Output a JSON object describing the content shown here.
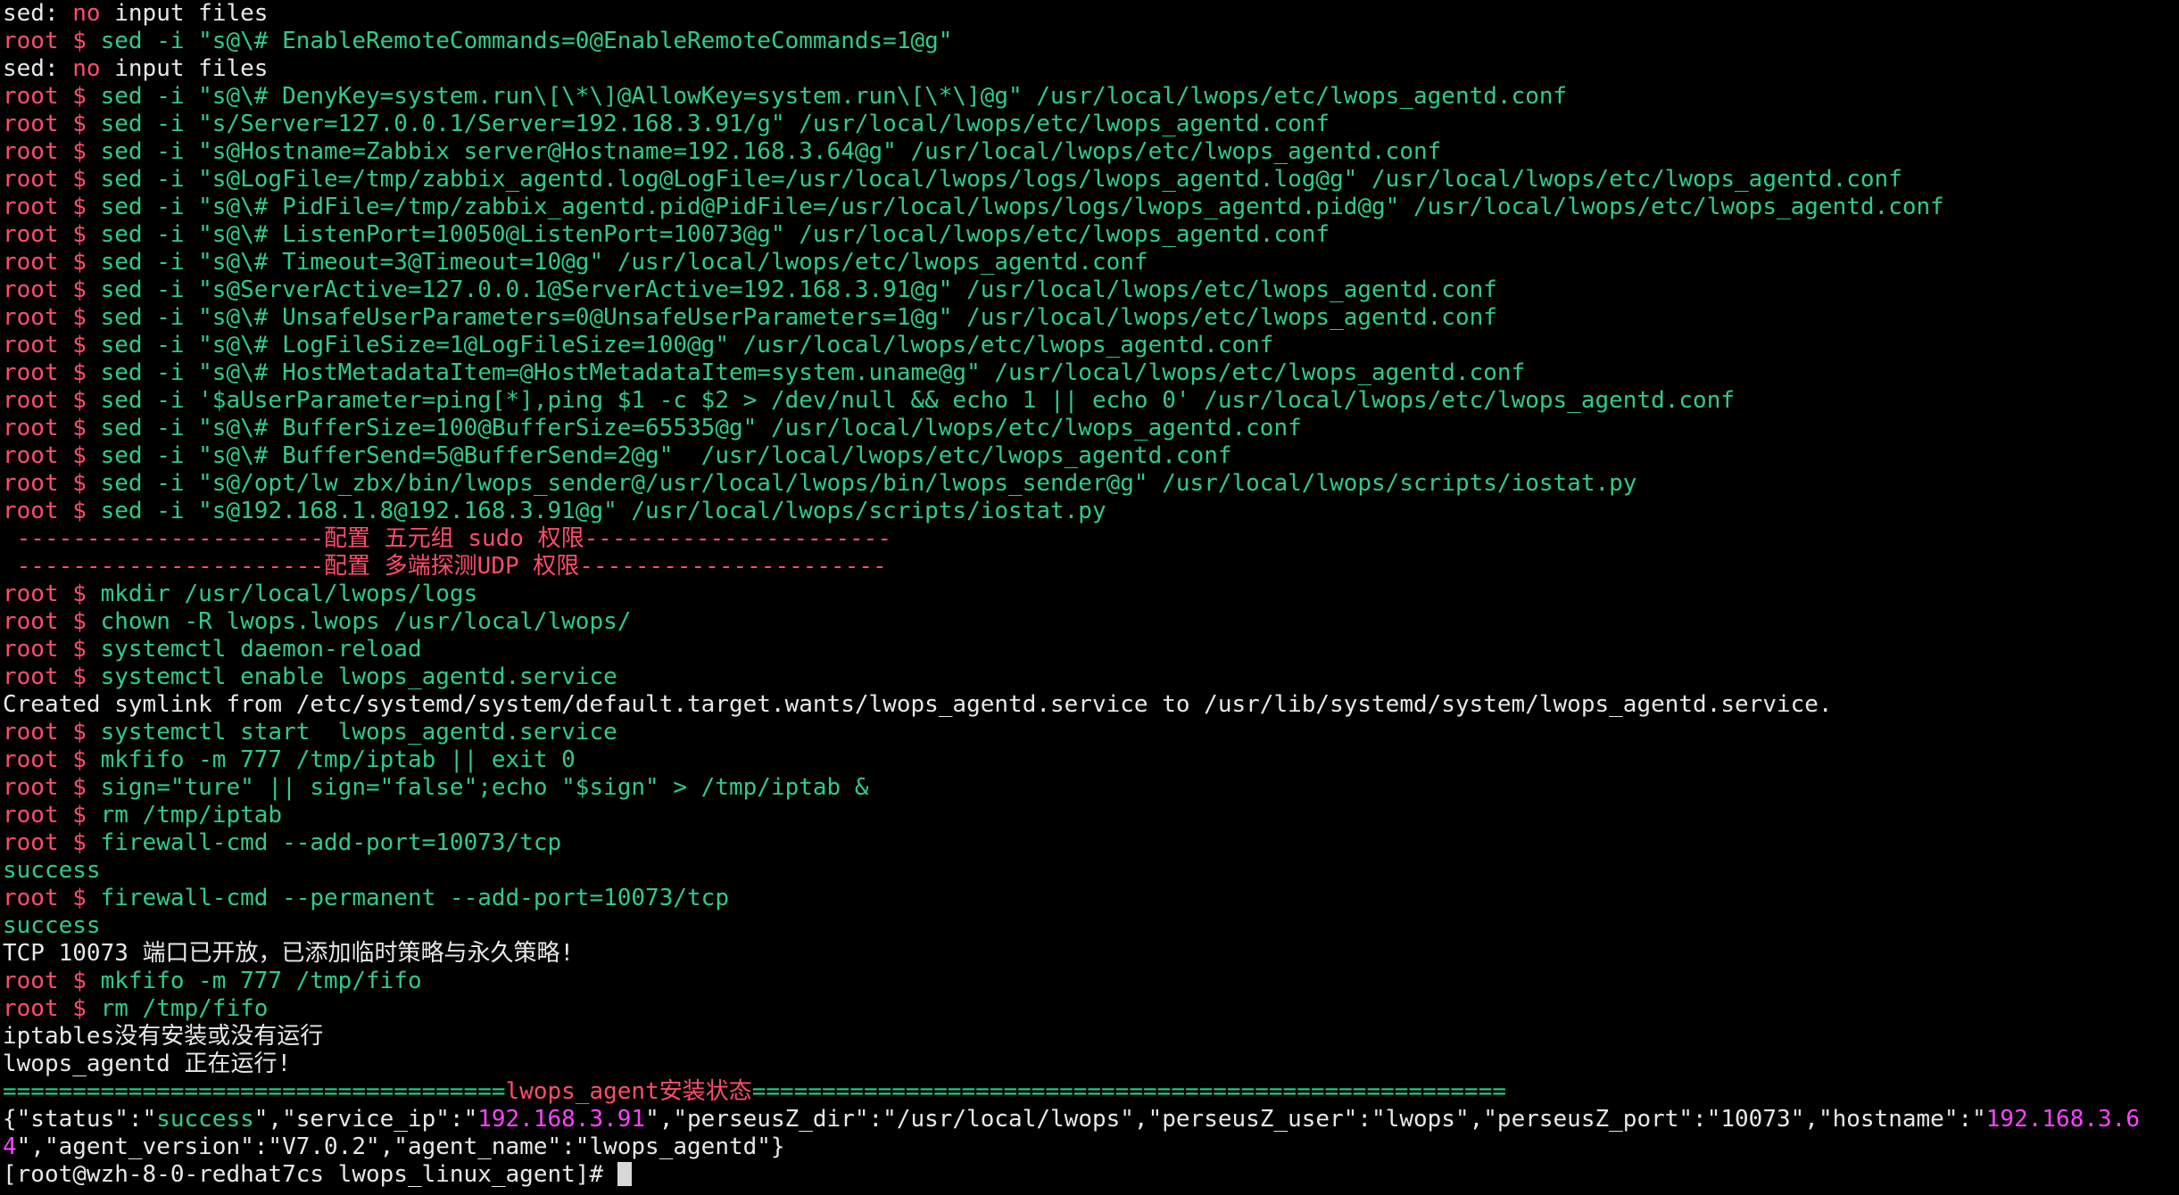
{
  "terminal": {
    "lines": [
      [
        [
          "w",
          "sed: "
        ],
        [
          "r",
          "no"
        ],
        [
          "w",
          " input files"
        ]
      ],
      [
        [
          "r",
          "root $ "
        ],
        [
          "g",
          "sed -i \"s@\\# EnableRemoteCommands=0@EnableRemoteCommands=1@g\""
        ]
      ],
      [
        [
          "w",
          "sed: "
        ],
        [
          "r",
          "no"
        ],
        [
          "w",
          " input files"
        ]
      ],
      [
        [
          "r",
          "root $ "
        ],
        [
          "g",
          "sed -i \"s@\\# DenyKey=system.run\\[\\*\\]@AllowKey=system.run\\[\\*\\]@g\" /usr/local/lwops/etc/lwops_agentd.conf"
        ]
      ],
      [
        [
          "r",
          "root $ "
        ],
        [
          "g",
          "sed -i \"s/Server=127.0.0.1/Server=192.168.3.91/g\" /usr/local/lwops/etc/lwops_agentd.conf"
        ]
      ],
      [
        [
          "r",
          "root $ "
        ],
        [
          "g",
          "sed -i \"s@Hostname=Zabbix server@Hostname=192.168.3.64@g\" /usr/local/lwops/etc/lwops_agentd.conf"
        ]
      ],
      [
        [
          "r",
          "root $ "
        ],
        [
          "g",
          "sed -i \"s@LogFile=/tmp/zabbix_agentd.log@LogFile=/usr/local/lwops/logs/lwops_agentd.log@g\" /usr/local/lwops/etc/lwops_agentd.conf"
        ]
      ],
      [
        [
          "r",
          "root $ "
        ],
        [
          "g",
          "sed -i \"s@\\# PidFile=/tmp/zabbix_agentd.pid@PidFile=/usr/local/lwops/logs/lwops_agentd.pid@g\" /usr/local/lwops/etc/lwops_agentd.conf"
        ]
      ],
      [
        [
          "r",
          "root $ "
        ],
        [
          "g",
          "sed -i \"s@\\# ListenPort=10050@ListenPort=10073@g\" /usr/local/lwops/etc/lwops_agentd.conf"
        ]
      ],
      [
        [
          "r",
          "root $ "
        ],
        [
          "g",
          "sed -i \"s@\\# Timeout=3@Timeout=10@g\" /usr/local/lwops/etc/lwops_agentd.conf"
        ]
      ],
      [
        [
          "r",
          "root $ "
        ],
        [
          "g",
          "sed -i \"s@ServerActive=127.0.0.1@ServerActive=192.168.3.91@g\" /usr/local/lwops/etc/lwops_agentd.conf"
        ]
      ],
      [
        [
          "r",
          "root $ "
        ],
        [
          "g",
          "sed -i \"s@\\# UnsafeUserParameters=0@UnsafeUserParameters=1@g\" /usr/local/lwops/etc/lwops_agentd.conf"
        ]
      ],
      [
        [
          "r",
          "root $ "
        ],
        [
          "g",
          "sed -i \"s@\\# LogFileSize=1@LogFileSize=100@g\" /usr/local/lwops/etc/lwops_agentd.conf"
        ]
      ],
      [
        [
          "r",
          "root $ "
        ],
        [
          "g",
          "sed -i \"s@\\# HostMetadataItem=@HostMetadataItem=system.uname@g\" /usr/local/lwops/etc/lwops_agentd.conf"
        ]
      ],
      [
        [
          "r",
          "root $ "
        ],
        [
          "g",
          "sed -i '$aUserParameter=ping[*],ping $1 -c $2 > /dev/null && echo 1 || echo 0' /usr/local/lwops/etc/lwops_agentd.conf"
        ]
      ],
      [
        [
          "r",
          "root $ "
        ],
        [
          "g",
          "sed -i \"s@\\# BufferSize=100@BufferSize=65535@g\" /usr/local/lwops/etc/lwops_agentd.conf"
        ]
      ],
      [
        [
          "r",
          "root $ "
        ],
        [
          "g",
          "sed -i \"s@\\# BufferSend=5@BufferSend=2@g\"  /usr/local/lwops/etc/lwops_agentd.conf"
        ]
      ],
      [
        [
          "r",
          "root $ "
        ],
        [
          "g",
          "sed -i \"s@/opt/lw_zbx/bin/lwops_sender@/usr/local/lwops/bin/lwops_sender@g\" /usr/local/lwops/scripts/iostat.py"
        ]
      ],
      [
        [
          "r",
          "root $ "
        ],
        [
          "g",
          "sed -i \"s@192.168.1.8@192.168.3.91@g\" /usr/local/lwops/scripts/iostat.py"
        ]
      ],
      [
        [
          "r",
          " ----------------------配置 五元组 sudo 权限----------------------"
        ]
      ],
      [
        [
          "r",
          " ----------------------配置 多端探测UDP 权限----------------------"
        ]
      ],
      [
        [
          "r",
          "root $ "
        ],
        [
          "g",
          "mkdir /usr/local/lwops/logs"
        ]
      ],
      [
        [
          "r",
          "root $ "
        ],
        [
          "g",
          "chown -R lwops.lwops /usr/local/lwops/"
        ]
      ],
      [
        [
          "r",
          "root $ "
        ],
        [
          "g",
          "systemctl daemon-reload"
        ]
      ],
      [
        [
          "r",
          "root $ "
        ],
        [
          "g",
          "systemctl enable lwops_agentd.service"
        ]
      ],
      [
        [
          "w",
          "Created symlink from /etc/systemd/system/default.target.wants/lwops_agentd.service to /usr/lib/systemd/system/lwops_agentd.service."
        ]
      ],
      [
        [
          "r",
          "root $ "
        ],
        [
          "g",
          "systemctl start  lwops_agentd.service"
        ]
      ],
      [
        [
          "r",
          "root $ "
        ],
        [
          "g",
          "mkfifo -m 777 /tmp/iptab || exit 0"
        ]
      ],
      [
        [
          "r",
          "root $ "
        ],
        [
          "g",
          "sign=\"ture\" || sign=\"false\";echo \"$sign\" > /tmp/iptab &"
        ]
      ],
      [
        [
          "r",
          "root $ "
        ],
        [
          "g",
          "rm /tmp/iptab"
        ]
      ],
      [
        [
          "r",
          "root $ "
        ],
        [
          "g",
          "firewall-cmd --add-port=10073/tcp"
        ]
      ],
      [
        [
          "g",
          "success"
        ]
      ],
      [
        [
          "r",
          "root $ "
        ],
        [
          "g",
          "firewall-cmd --permanent --add-port=10073/tcp"
        ]
      ],
      [
        [
          "g",
          "success"
        ]
      ],
      [
        [
          "w",
          "TCP 10073 端口已开放，已添加临时策略与永久策略!"
        ]
      ],
      [
        [
          "r",
          "root $ "
        ],
        [
          "g",
          "mkfifo -m 777 /tmp/fifo"
        ]
      ],
      [
        [
          "r",
          "root $ "
        ],
        [
          "g",
          "rm /tmp/fifo"
        ]
      ],
      [
        [
          "w",
          "iptables没有安装或没有运行"
        ]
      ],
      [
        [
          "w",
          "lwops_agentd 正在运行!"
        ]
      ],
      [
        [
          "g",
          "===================================="
        ],
        [
          "r",
          "lwops_agent安装状态"
        ],
        [
          "g",
          "======================================================"
        ]
      ],
      [
        [
          "w",
          "{\"status\":\""
        ],
        [
          "g",
          "success"
        ],
        [
          "w",
          "\",\"service_ip\":\""
        ],
        [
          "m",
          "192.168.3.91"
        ],
        [
          "w",
          "\",\"perseusZ_dir\":\"/usr/local/lwops\",\"perseusZ_user\":\"lwops\",\"perseusZ_port\":\"10073\",\"hostname\":\""
        ],
        [
          "m",
          "192.168.3.64"
        ],
        [
          "w",
          "\",\"agent_version\":\"V7.0.2\",\"agent_name\":\"lwops_agentd\"}"
        ]
      ]
    ],
    "prompt": "[root@wzh-8-0-redhat7cs lwops_linux_agent]# ",
    "colors": {
      "background": "#000000",
      "red": "#ff4d6a",
      "green": "#2ecc8a",
      "white": "#e8e8e8",
      "magenta": "#ff44ff"
    }
  }
}
